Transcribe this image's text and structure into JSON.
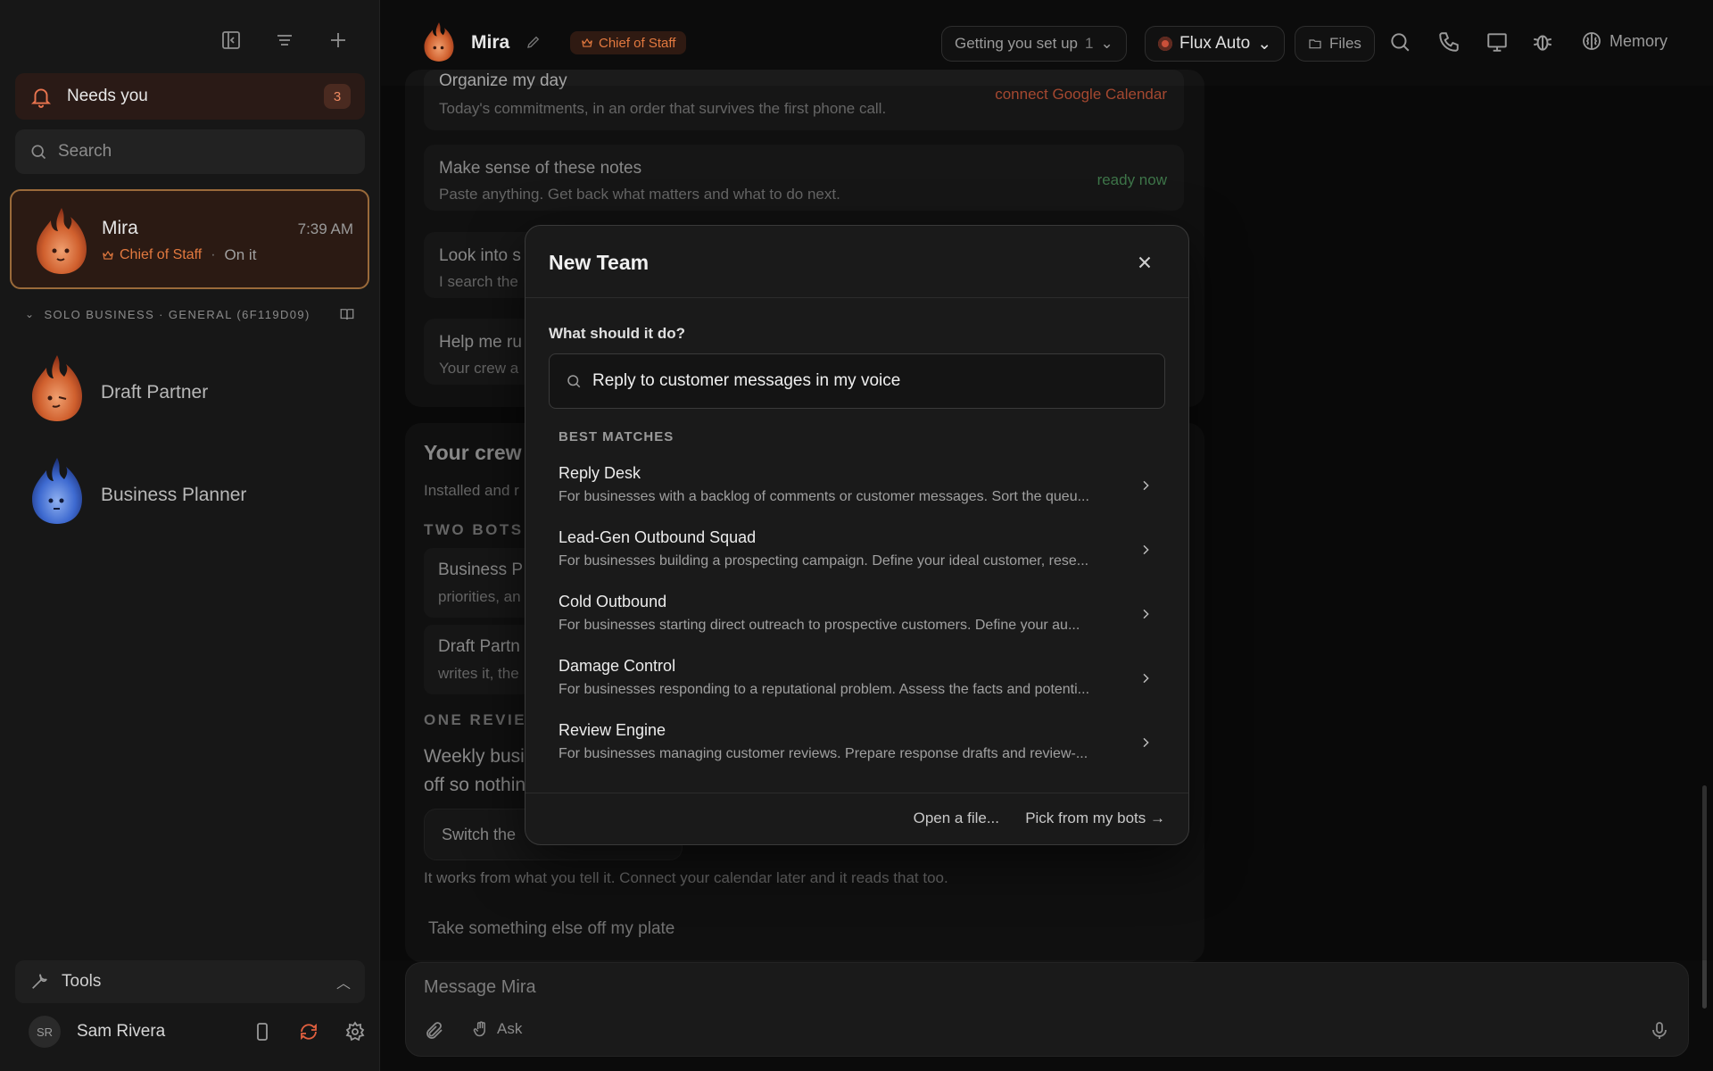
{
  "sidebar": {
    "needs_you": {
      "label": "Needs you",
      "count": "3"
    },
    "search_placeholder": "Search",
    "active_bot": {
      "name": "Mira",
      "time": "7:39 AM",
      "role": "Chief of Staff",
      "status": "On it"
    },
    "group_label": "SOLO BUSINESS · GENERAL (6F119D09)",
    "bots": [
      {
        "name": "Draft Partner"
      },
      {
        "name": "Business Planner"
      }
    ],
    "tools_label": "Tools",
    "user": {
      "initials": "SR",
      "name": "Sam Rivera"
    }
  },
  "header": {
    "title": "Mira",
    "role": "Chief of Staff",
    "setup_label": "Getting you set up",
    "setup_count": "1",
    "model": "Flux Auto",
    "files_label": "Files",
    "memory_label": "Memory"
  },
  "main": {
    "tasks": [
      {
        "title": "Organize my day",
        "subtitle": "Today's commitments, in an order that survives the first phone call.",
        "right": "connect Google Calendar"
      },
      {
        "title": "Make sense of these notes",
        "subtitle": "Paste anything. Get back what matters and what to do next.",
        "right": "ready now"
      },
      {
        "title": "Look into s",
        "subtitle": "I search the",
        "right": ""
      },
      {
        "title": "Help me ru",
        "subtitle": "Your crew a",
        "right": ""
      }
    ],
    "crew_title": "Your crew",
    "crew_sub": "Installed and r",
    "two_bots_label": "TWO BOTS",
    "mini_cards": [
      {
        "title": "Business P",
        "subtitle": "priorities, an"
      },
      {
        "title": "Draft Partn",
        "subtitle": "writes it, the"
      }
    ],
    "one_review_label": "ONE REVIEW",
    "review_line1": "Weekly busi",
    "review_line2": "off so nothin",
    "switch_label": "Switch the",
    "works_text": "It works from what you tell it. Connect your calendar later and it reads that too.",
    "plate_label": "Take something else off my plate"
  },
  "composer": {
    "placeholder": "Message Mira",
    "ask_label": "Ask"
  },
  "modal": {
    "title": "New Team",
    "question": "What should it do?",
    "input_value": "Reply to customer messages in my voice",
    "best_matches_label": "BEST MATCHES",
    "matches": [
      {
        "title": "Reply Desk",
        "desc": "For businesses with a backlog of comments or customer messages. Sort the queu..."
      },
      {
        "title": "Lead-Gen Outbound Squad",
        "desc": "For businesses building a prospecting campaign. Define your ideal customer, rese..."
      },
      {
        "title": "Cold Outbound",
        "desc": "For businesses starting direct outreach to prospective customers. Define your au..."
      },
      {
        "title": "Damage Control",
        "desc": "For businesses responding to a reputational problem. Assess the facts and potenti..."
      },
      {
        "title": "Review Engine",
        "desc": "For businesses managing customer reviews. Prepare response drafts and review-..."
      }
    ],
    "open_file_label": "Open a file...",
    "pick_bots_label": "Pick from my bots →"
  },
  "colors": {
    "accent": "#e2793f",
    "ready": "#4c8f5a",
    "connect": "#c9583b"
  }
}
